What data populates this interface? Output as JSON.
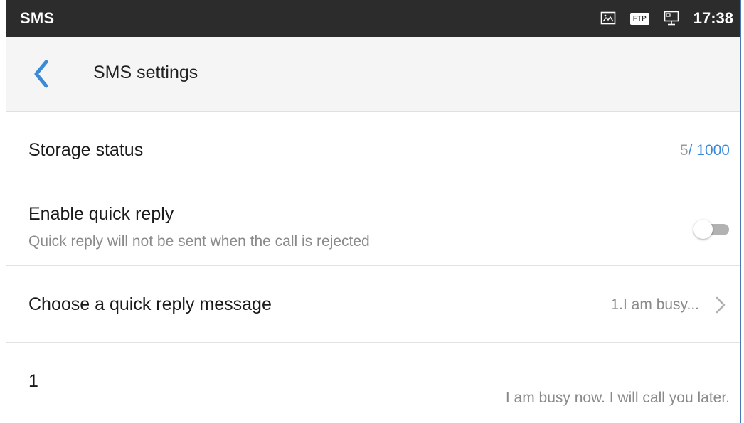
{
  "statusbar": {
    "app_name": "SMS",
    "time": "17:38",
    "icons": [
      "image-icon",
      "ftp-icon",
      "screen-icon"
    ],
    "ftp_badge": "FTP"
  },
  "header": {
    "title": "SMS settings",
    "back_icon": "chevron-left-icon"
  },
  "settings": {
    "storage": {
      "label": "Storage status",
      "used": "5",
      "separator": "/",
      "total": " 1000"
    },
    "quick_reply": {
      "label": "Enable quick reply",
      "description": "Quick reply will not be sent when the call is rejected",
      "enabled": false
    },
    "choose_reply": {
      "label": "Choose a quick reply message",
      "value": "1.I am busy...",
      "icon": "chevron-right-icon"
    },
    "message": {
      "label": "1",
      "text": "I am busy now. I will call you later."
    }
  },
  "colors": {
    "accent": "#3c8ad6",
    "statusbar": "#2c2c2c",
    "titlebar": "#f5f5f5",
    "secondary_text": "#8a8a8a",
    "frame": "#4a78b8"
  }
}
